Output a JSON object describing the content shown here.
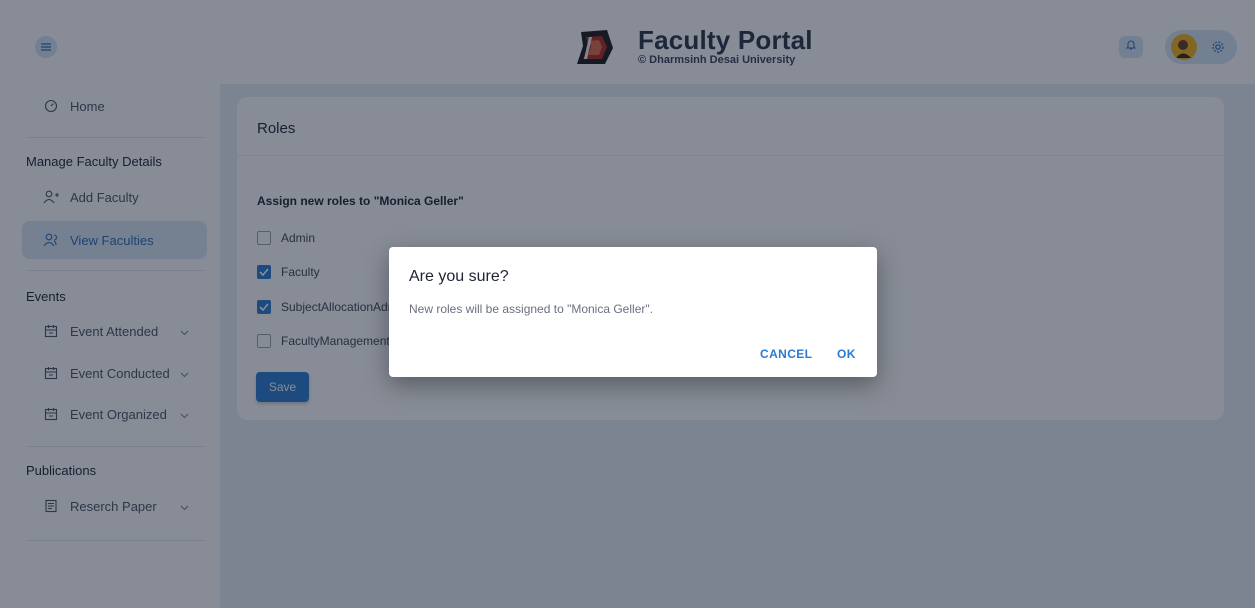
{
  "header": {
    "title": "Faculty Portal",
    "subtitle": "© Dharmsinh Desai University"
  },
  "sidebar": {
    "home_label": "Home",
    "section_manage": "Manage Faculty Details",
    "add_faculty_label": "Add Faculty",
    "view_faculties_label": "View Faculties",
    "section_events": "Events",
    "event_attended_label": "Event Attended",
    "event_conducted_label": "Event Conducted",
    "event_organized_label": "Event Organized",
    "section_publications": "Publications",
    "research_paper_label": "Reserch Paper",
    "active_item": "View Faculties"
  },
  "main": {
    "card_title": "Roles",
    "assign_label": "Assign new roles to \"Monica Geller\"",
    "roles": [
      {
        "label": "Admin",
        "checked": false
      },
      {
        "label": "Faculty",
        "checked": true
      },
      {
        "label": "SubjectAllocationAdr",
        "checked": true
      },
      {
        "label": "FacultyManagementA",
        "checked": false
      }
    ],
    "save_label": "Save"
  },
  "dialog": {
    "title": "Are you sure?",
    "message": "New roles will be assigned to \"Monica Geller\".",
    "cancel_label": "CANCEL",
    "ok_label": "OK"
  },
  "colors": {
    "accent": "#2a7bd0",
    "active_bg": "#dbe6f2",
    "overlay": "rgba(15,25,45,0.5)"
  }
}
